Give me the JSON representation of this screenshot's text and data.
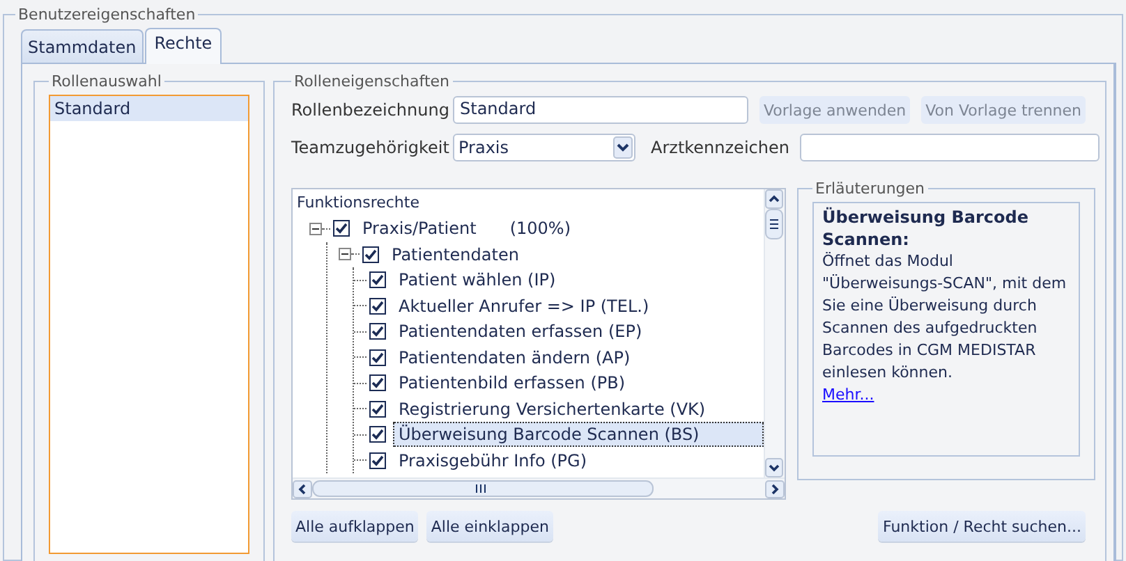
{
  "group_title": "Benutzereigenschaften",
  "tabs": [
    {
      "label": "Stammdaten",
      "selected": false
    },
    {
      "label": "Rechte",
      "selected": true
    }
  ],
  "role_selection": {
    "title": "Rollenauswahl",
    "items": [
      {
        "label": "Standard",
        "selected": true
      }
    ]
  },
  "role_properties": {
    "title": "Rolleneigenschaften",
    "role_name": {
      "label": "Rollenbezeichnung",
      "value": "Standard"
    },
    "template_buttons": [
      {
        "label": "Vorlage anwenden",
        "disabled": true
      },
      {
        "label": "Von Vorlage trennen",
        "disabled": true
      }
    ],
    "team": {
      "label": "Teamzugehörigkeit",
      "value": "Praxis"
    },
    "doctor_code": {
      "label": "Arztkennzeichen"
    }
  },
  "rights_tree": {
    "title": "Funktionsrechte",
    "nodes": [
      {
        "label": "Praxis/Patient",
        "percent": "(100%)",
        "checked": true,
        "expanded": true,
        "selected": false,
        "children": [
          {
            "label": "Patientendaten",
            "checked": true,
            "expanded": true,
            "selected": false,
            "children": [
              {
                "label": "Patient wählen (IP)",
                "checked": true,
                "selected": false
              },
              {
                "label": "Aktueller Anrufer => IP (TEL.)",
                "checked": true,
                "selected": false
              },
              {
                "label": "Patientendaten erfassen (EP)",
                "checked": true,
                "selected": false
              },
              {
                "label": "Patientendaten ändern (AP)",
                "checked": true,
                "selected": false
              },
              {
                "label": "Patientenbild erfassen (PB)",
                "checked": true,
                "selected": false
              },
              {
                "label": "Registrierung Versichertenkarte (VK)",
                "checked": true,
                "selected": false
              },
              {
                "label": "Überweisung Barcode Scannen (BS)",
                "checked": true,
                "selected": true
              },
              {
                "label": "Praxisgebühr Info (PG)",
                "checked": true,
                "selected": false
              }
            ]
          }
        ]
      }
    ]
  },
  "explanation": {
    "title": "Erläuterungen",
    "heading": "Überweisung Barcode Scannen:",
    "body": "Öffnet das Modul \"Überweisungs-SCAN\", mit dem Sie eine Überweisung durch Scannen des aufgedruckten Barcodes in CGM MEDISTAR einlesen können.",
    "link": "Mehr..."
  },
  "buttons": [
    "Alle aufklappen",
    "Alle einklappen"
  ],
  "search_button": "Funktion / Recht suchen..."
}
